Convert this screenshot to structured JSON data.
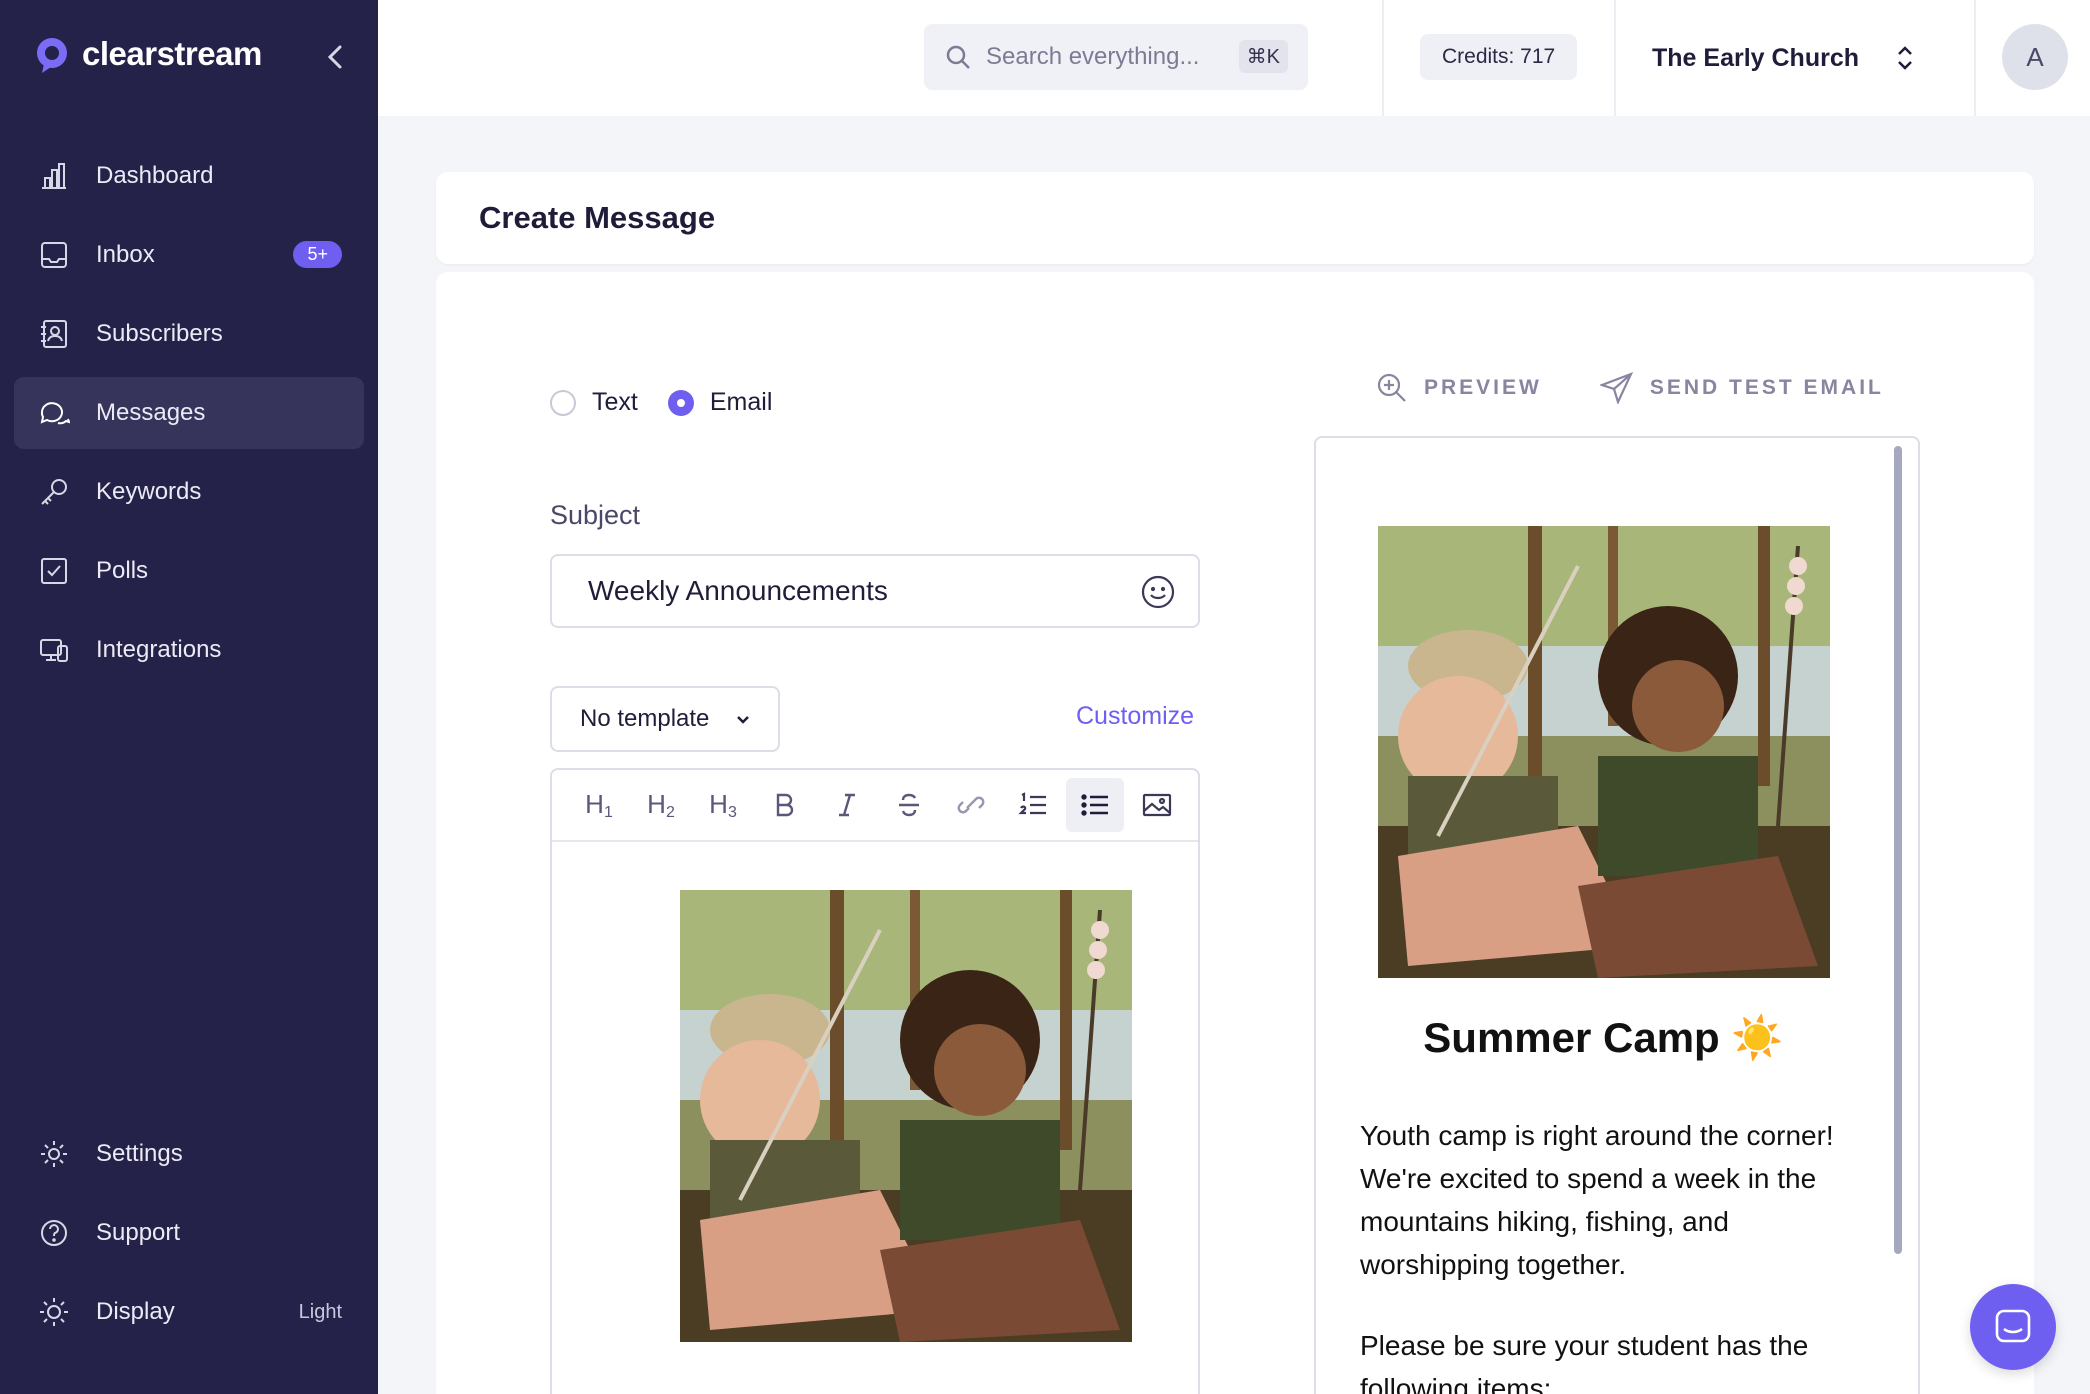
{
  "app": {
    "brand": "clearstream"
  },
  "sidebar": {
    "items": [
      {
        "label": "Dashboard",
        "icon": "bar-chart-icon"
      },
      {
        "label": "Inbox",
        "icon": "inbox-icon",
        "badge": "5+"
      },
      {
        "label": "Subscribers",
        "icon": "contacts-icon"
      },
      {
        "label": "Messages",
        "icon": "chat-bubbles-icon",
        "active": true
      },
      {
        "label": "Keywords",
        "icon": "key-icon"
      },
      {
        "label": "Polls",
        "icon": "checkbox-icon"
      },
      {
        "label": "Integrations",
        "icon": "devices-icon"
      }
    ],
    "bottom": [
      {
        "label": "Settings",
        "icon": "gear-icon"
      },
      {
        "label": "Support",
        "icon": "help-circle-icon"
      },
      {
        "label": "Display",
        "icon": "sun-icon",
        "value": "Light"
      }
    ]
  },
  "header": {
    "search_placeholder": "Search everything...",
    "search_shortcut": "⌘K",
    "credits": "Credits: 717",
    "organization": "The Early Church",
    "avatar_initial": "A"
  },
  "page": {
    "title": "Create Message"
  },
  "composer": {
    "message_types": [
      {
        "label": "Text",
        "checked": false
      },
      {
        "label": "Email",
        "checked": true
      }
    ],
    "subject_label": "Subject",
    "subject_value": "Weekly Announcements",
    "template_value": "No template",
    "customize_label": "Customize",
    "toolbar": [
      "H1",
      "H2",
      "H3",
      "B",
      "I",
      "S",
      "link",
      "ordered-list",
      "bullet-list",
      "image"
    ]
  },
  "preview": {
    "preview_label": "PREVIEW",
    "send_test_label": "SEND TEST EMAIL",
    "title": "Summer Camp",
    "title_emoji": "☀️",
    "paragraph1": "Youth camp is right around the corner! We're excited to spend a week in the mountains hiking, fishing, and worshipping together.",
    "paragraph2": "Please be sure your student has the following items:"
  },
  "colors": {
    "sidebar": "#25224a",
    "accent": "#6e5ff0",
    "background": "#f4f5f8"
  }
}
